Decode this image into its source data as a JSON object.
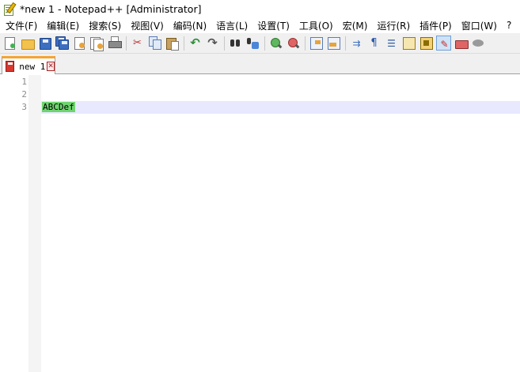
{
  "window": {
    "title": "*new 1 - Notepad++ [Administrator]"
  },
  "menu": [
    "文件(F)",
    "编辑(E)",
    "搜索(S)",
    "视图(V)",
    "编码(N)",
    "语言(L)",
    "设置(T)",
    "工具(O)",
    "宏(M)",
    "运行(R)",
    "插件(P)",
    "窗口(W)",
    "?"
  ],
  "toolbar": {
    "icons": [
      "new-file-icon",
      "open-file-icon",
      "save-icon",
      "save-all-icon",
      "close-icon",
      "close-all-icon",
      "print-icon",
      "cut-icon",
      "copy-icon",
      "paste-icon",
      "undo-icon",
      "redo-icon",
      "find-icon",
      "replace-icon",
      "zoom-in-icon",
      "zoom-out-icon",
      "sync-vertical-icon",
      "sync-horizontal-icon",
      "word-wrap-icon",
      "show-all-chars-icon",
      "indent-guide-icon",
      "doc-map-icon",
      "function-list-icon",
      "folder-as-workspace-icon",
      "macro-record-icon",
      "macro-stop-icon"
    ]
  },
  "tabs": [
    {
      "label": "new 1",
      "close": "✕"
    }
  ],
  "editor": {
    "line_numbers": [
      "1",
      "2",
      "3"
    ],
    "lines": [
      "",
      "",
      "ABCDef"
    ],
    "current_line_index": 2,
    "selection_color": "#6fd46f",
    "current_line_color": "#e8e8ff"
  },
  "colors": {
    "tab_accent": "#f7a330"
  }
}
